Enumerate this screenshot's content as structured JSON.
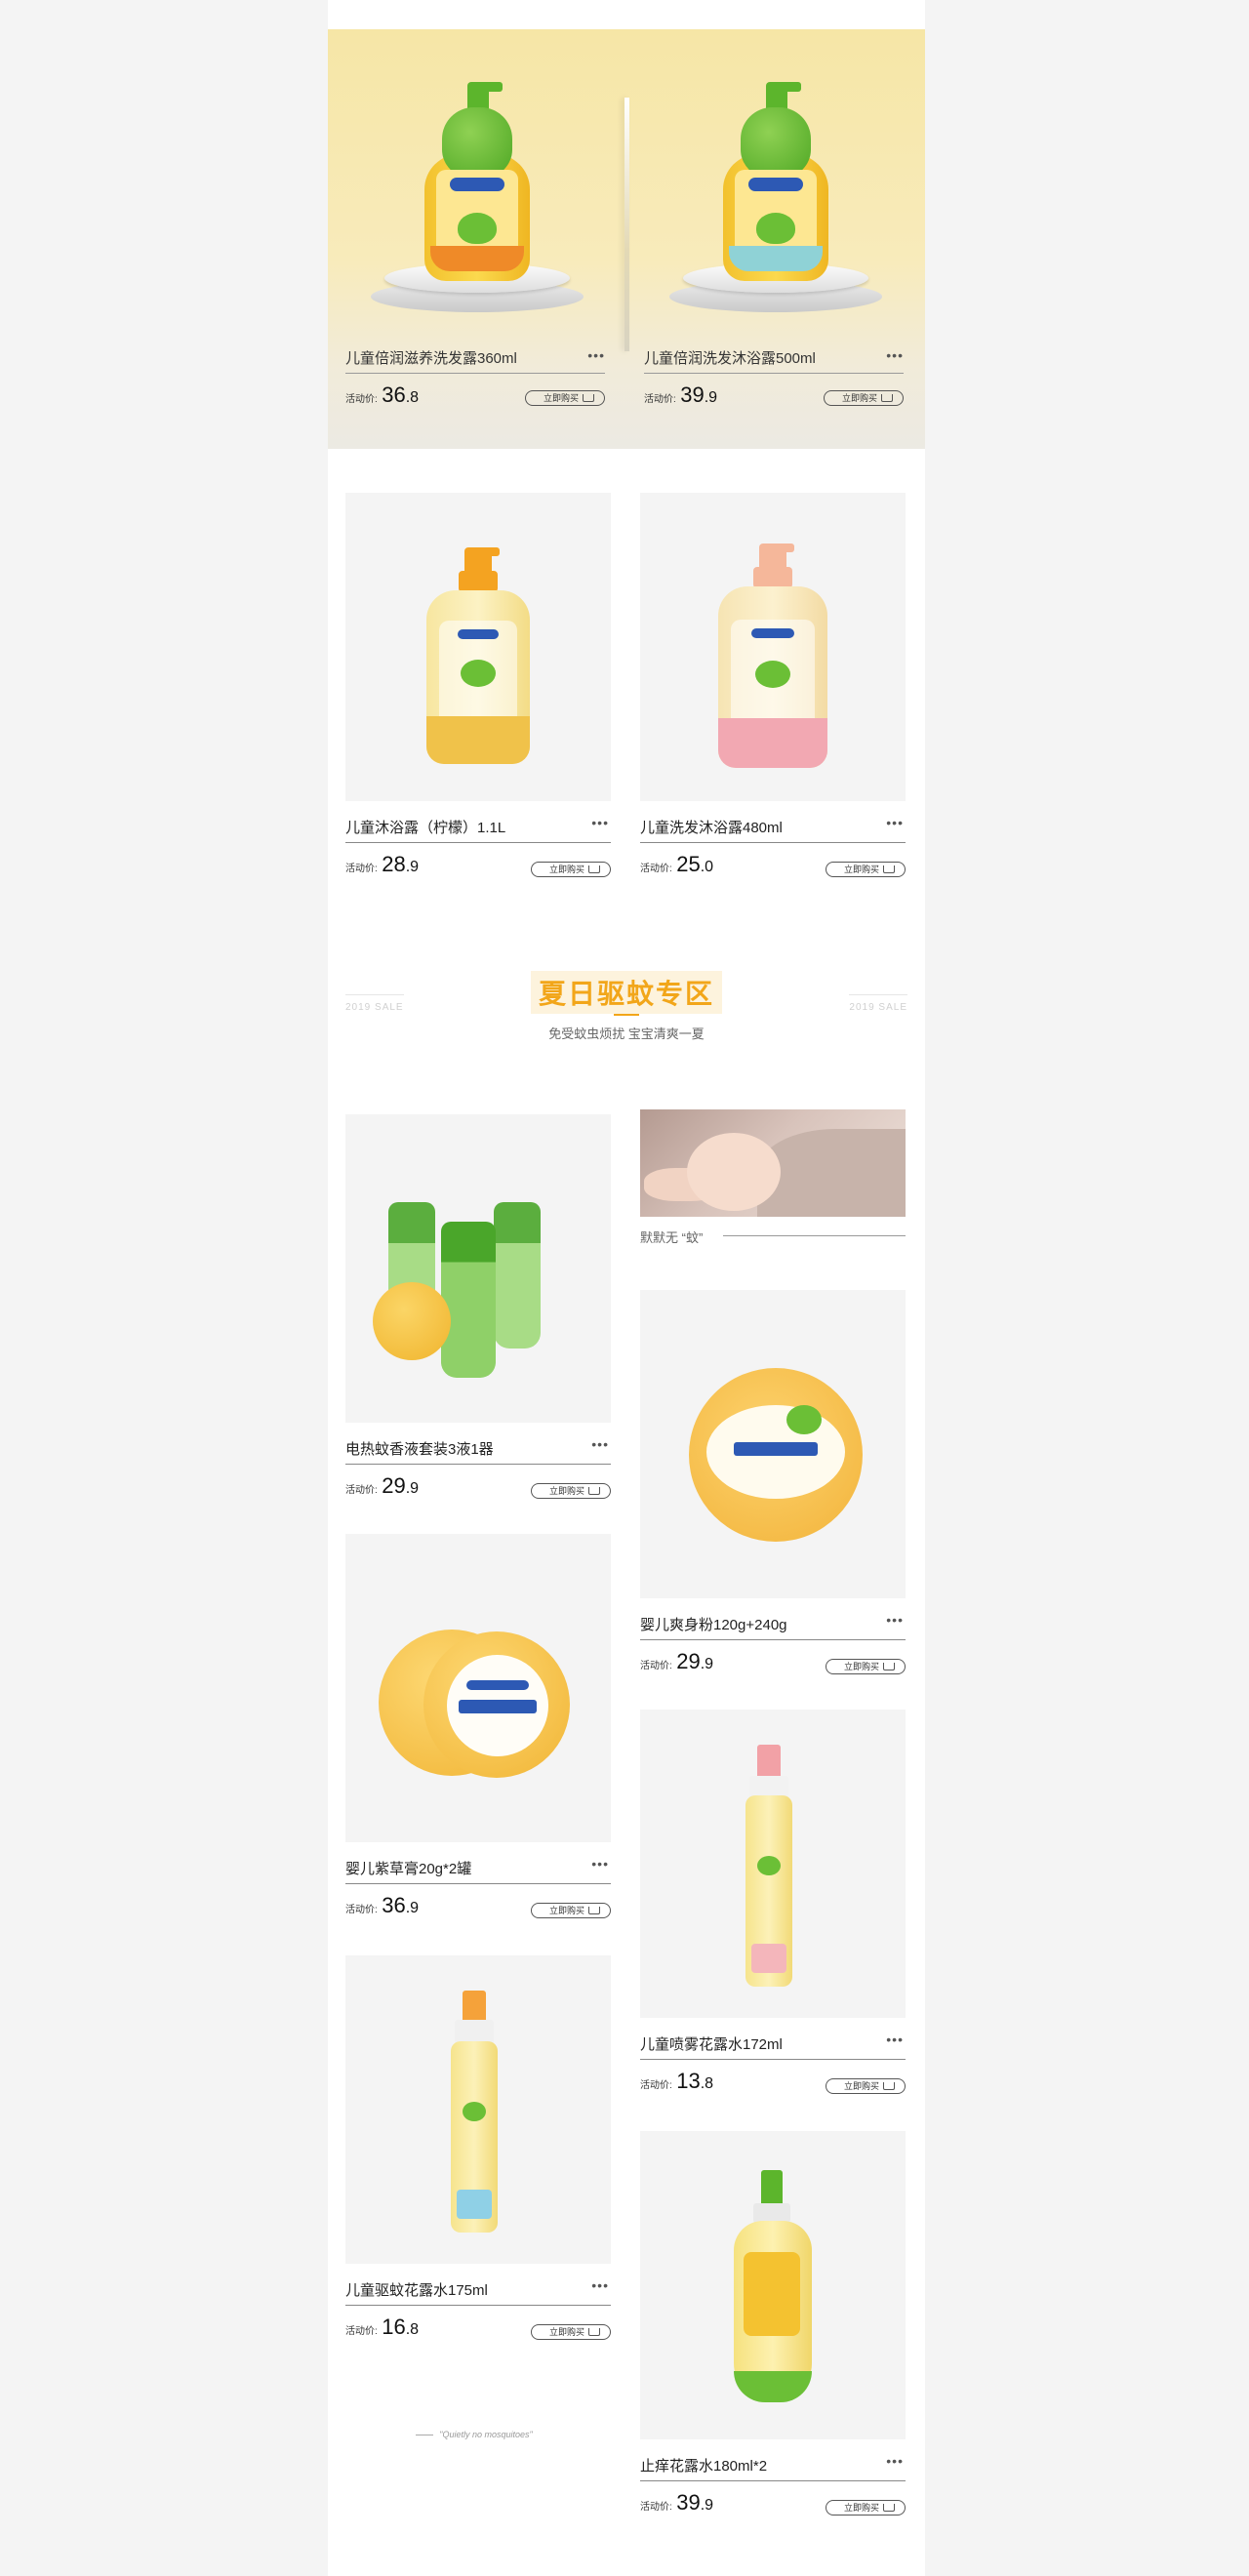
{
  "hero": {
    "products": [
      {
        "name": "儿童倍润滋养洗发露360ml",
        "price_label": "活动价:",
        "price_int": "36",
        "price_dec": ".8",
        "buy_label": "立即购买",
        "more": "•••"
      },
      {
        "name": "儿童倍润洗发沐浴露500ml",
        "price_label": "活动价:",
        "price_int": "39",
        "price_dec": ".9",
        "buy_label": "立即购买",
        "more": "•••"
      }
    ]
  },
  "row1": [
    {
      "name": "儿童沐浴露（柠檬）1.1L",
      "price_label": "活动价:",
      "price_int": "28",
      "price_dec": ".9",
      "buy_label": "立即购买",
      "more": "•••"
    },
    {
      "name": "儿童洗发沐浴露480ml",
      "price_label": "活动价:",
      "price_int": "25",
      "price_dec": ".0",
      "buy_label": "立即购买",
      "more": "•••"
    }
  ],
  "section": {
    "title": "夏日驱蚊专区",
    "subtitle": "免受蚊虫烦扰 宝宝清爽一夏",
    "side_left": "2019 SALE",
    "side_right": "2019 SALE"
  },
  "baby": {
    "caption": "默默无 “蚊”"
  },
  "left_column": [
    {
      "name": "电热蚊香液套装3液1器",
      "price_label": "活动价:",
      "price_int": "29",
      "price_dec": ".9",
      "buy_label": "立即购买",
      "more": "•••"
    },
    {
      "name": "婴儿紫草膏20g*2罐",
      "price_label": "活动价:",
      "price_int": "36",
      "price_dec": ".9",
      "buy_label": "立即购买",
      "more": "•••"
    },
    {
      "name": "儿童驱蚊花露水175ml",
      "price_label": "活动价:",
      "price_int": "16",
      "price_dec": ".8",
      "buy_label": "立即购买",
      "more": "•••"
    }
  ],
  "right_column": [
    {
      "name": "婴儿爽身粉120g+240g",
      "price_label": "活动价:",
      "price_int": "29",
      "price_dec": ".9",
      "buy_label": "立即购买",
      "more": "•••"
    },
    {
      "name": "儿童喷雾花露水172ml",
      "price_label": "活动价:",
      "price_int": "13",
      "price_dec": ".8",
      "buy_label": "立即购买",
      "more": "•••"
    },
    {
      "name": "止痒花露水180ml*2",
      "price_label": "活动价:",
      "price_int": "39",
      "price_dec": ".9",
      "buy_label": "立即购买",
      "more": "•••"
    }
  ],
  "footer": {
    "note": "\"Quietly no mosquitoes\""
  },
  "colors": {
    "accent": "#f2a61a",
    "brand_green": "#5cb52c",
    "brand_blue": "#2d59b4"
  }
}
